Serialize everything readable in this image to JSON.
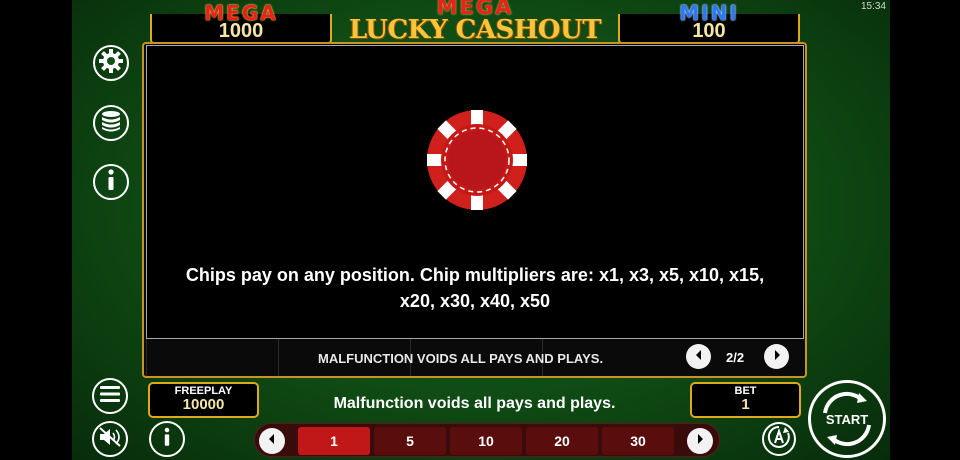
{
  "status_bar": {
    "time": "15:34"
  },
  "jackpots": {
    "left": {
      "title": "MEGA",
      "value": "1000"
    },
    "right": {
      "title": "MINI",
      "value": "100"
    }
  },
  "logo": {
    "line1": "MEGA",
    "line2": "LUCKY CASHOUT"
  },
  "side_icons": [
    "gear-icon",
    "coins-stack-icon",
    "info-icon"
  ],
  "info_panel": {
    "text": "Chips pay on any position. Chip multipliers are: x1, x3, x5, x10, x15, x20, x30, x40, x50",
    "chip_color": "#d0201c"
  },
  "reel_footer": {
    "disclaimer": "MALFUNCTION VOIDS ALL PAYS AND PLAYS.",
    "page": "2/2"
  },
  "bottom": {
    "freeplay_label": "FREEPLAY",
    "freeplay_value": "10000",
    "disclaimer": "Malfunction voids all pays and plays.",
    "bet_label": "BET",
    "bet_value": "1",
    "bet_options": [
      "1",
      "5",
      "10",
      "20",
      "30"
    ],
    "selected_bet": "1",
    "start_label": "START"
  },
  "colors": {
    "gold": "#e0a91a",
    "felt": "#1e6a22",
    "selected": "#c01818"
  }
}
